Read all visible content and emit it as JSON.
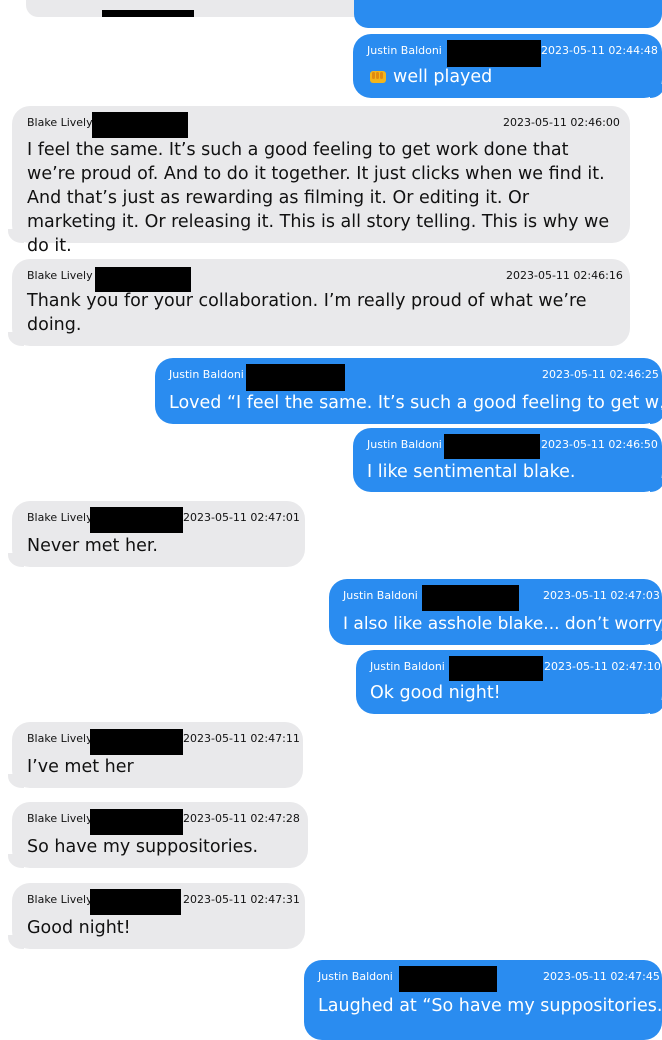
{
  "colors": {
    "sent_bubble": "#2a8cf0",
    "received_bubble": "#e9e9eb",
    "background": "#ffffff"
  },
  "messages": [
    {
      "direction": "sent",
      "sender": "Justin Baldoni",
      "timestamp": "2023-05-11 02:44:48",
      "text": "well played",
      "icon": "fist-bump-emoji-icon"
    },
    {
      "direction": "received",
      "sender": "Blake Lively",
      "timestamp": "2023-05-11 02:46:00",
      "text": "I feel the same. It’s such a good feeling to get work done that we’re proud of. And to do it together. It just clicks when we find it. And that’s just as rewarding as filming it. Or editing it. Or marketing it. Or releasing it. This is all story telling. This is why we do it."
    },
    {
      "direction": "received",
      "sender": "Blake Lively",
      "timestamp": "2023-05-11 02:46:16",
      "text": "Thank you for your collaboration. I’m really proud of what we’re doing."
    },
    {
      "direction": "sent",
      "sender": "Justin Baldoni",
      "timestamp": "2023-05-11 02:46:25",
      "text": "Loved “I feel the same. It’s such a good feeling to get w…”"
    },
    {
      "direction": "sent",
      "sender": "Justin Baldoni",
      "timestamp": "2023-05-11 02:46:50",
      "text": "I like sentimental blake."
    },
    {
      "direction": "received",
      "sender": "Blake Lively",
      "timestamp": "2023-05-11 02:47:01",
      "text": "Never met her."
    },
    {
      "direction": "sent",
      "sender": "Justin Baldoni",
      "timestamp": "2023-05-11 02:47:03",
      "text": "I also like asshole blake... don’t worry"
    },
    {
      "direction": "sent",
      "sender": "Justin Baldoni",
      "timestamp": "2023-05-11 02:47:10",
      "text": "Ok good night!"
    },
    {
      "direction": "received",
      "sender": "Blake Lively",
      "timestamp": "2023-05-11 02:47:11",
      "text": "I’ve met her"
    },
    {
      "direction": "received",
      "sender": "Blake Lively",
      "timestamp": "2023-05-11 02:47:28",
      "text": "So have my suppositories."
    },
    {
      "direction": "received",
      "sender": "Blake Lively",
      "timestamp": "2023-05-11 02:47:31",
      "text": "Good night!"
    },
    {
      "direction": "sent",
      "sender": "Justin Baldoni",
      "timestamp": "2023-05-11 02:47:45",
      "text": "Laughed at “So have my suppositories. ”"
    }
  ]
}
